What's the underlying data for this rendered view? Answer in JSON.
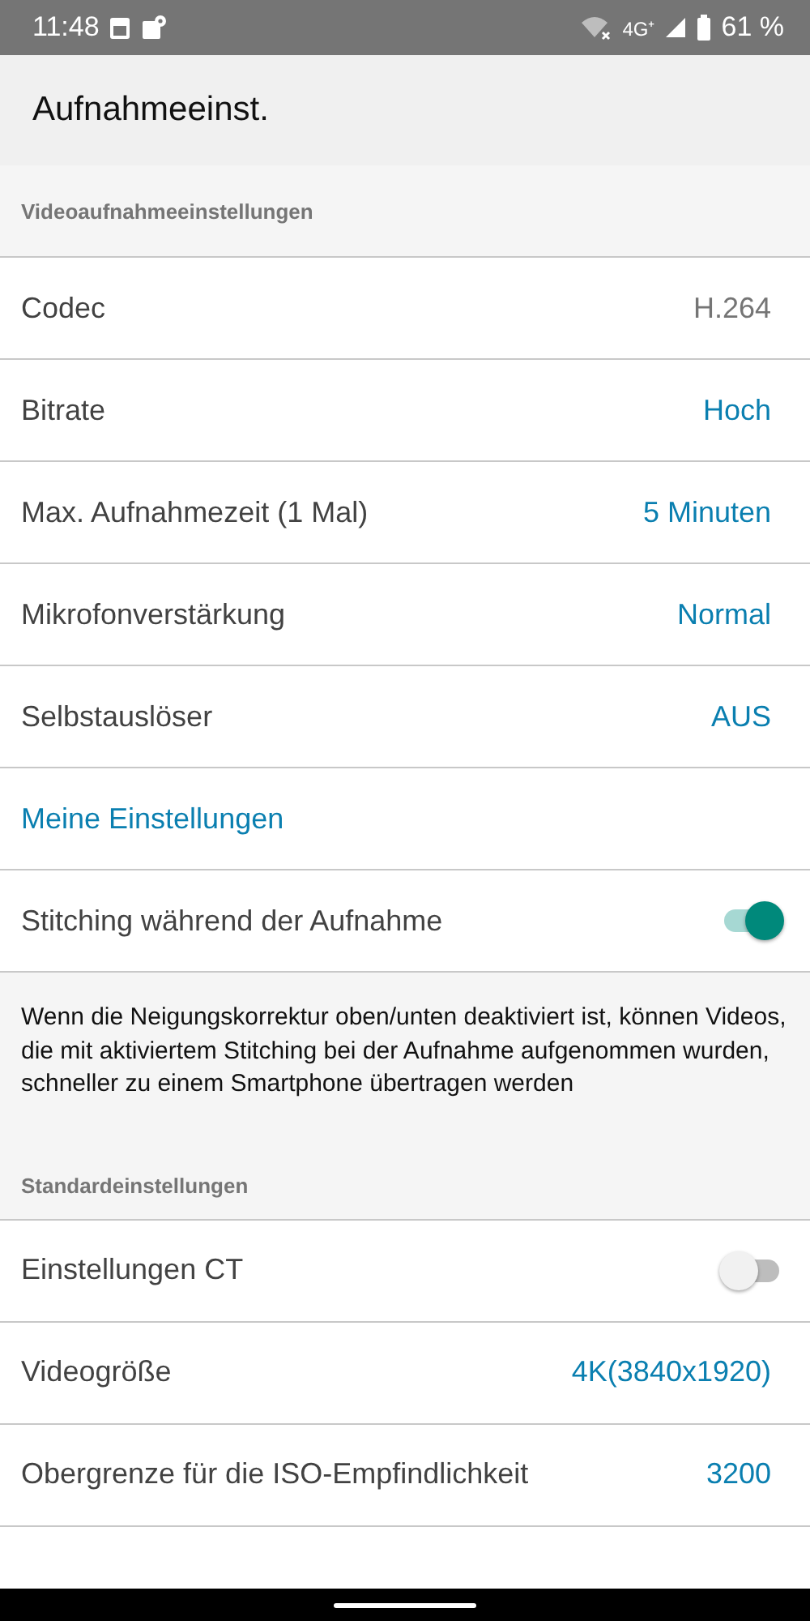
{
  "status_bar": {
    "time": "11:48",
    "network": "4G⁺",
    "battery": "61 %"
  },
  "app_bar": {
    "title": "Aufnahmeeinst."
  },
  "items": [
    {
      "kind": "header",
      "label": "Videoaufnahmeeinstellungen"
    },
    {
      "kind": "readonly",
      "label": "Codec",
      "value": "H.264"
    },
    {
      "kind": "choice",
      "label": "Bitrate",
      "value": "Hoch"
    },
    {
      "kind": "choice",
      "label": "Max. Aufnahmezeit (1 Mal)",
      "value": "5 Minuten"
    },
    {
      "kind": "choice",
      "label": "Mikrofonverstärkung",
      "value": "Normal"
    },
    {
      "kind": "choice",
      "label": "Selbstauslöser",
      "value": "AUS"
    },
    {
      "kind": "link",
      "label": "Meine Einstellungen"
    },
    {
      "kind": "toggle",
      "label": "Stitching während der Aufnahme",
      "on": true
    },
    {
      "kind": "note",
      "label": "Wenn die Neigungskorrektur oben/unten deaktiviert ist, können Videos, die mit aktiviertem Stitching bei der Aufnahme aufgenommen wurden, schneller zu einem Smartphone übertragen werden"
    },
    {
      "kind": "header",
      "label": "Standardeinstellungen"
    },
    {
      "kind": "toggle",
      "label": "Einstellungen CT",
      "on": false
    },
    {
      "kind": "choice",
      "label": "Videogröße",
      "value": "4K(3840x1920)"
    },
    {
      "kind": "choice",
      "label": "Obergrenze für die ISO-Empfindlichkeit",
      "value": "3200"
    }
  ]
}
